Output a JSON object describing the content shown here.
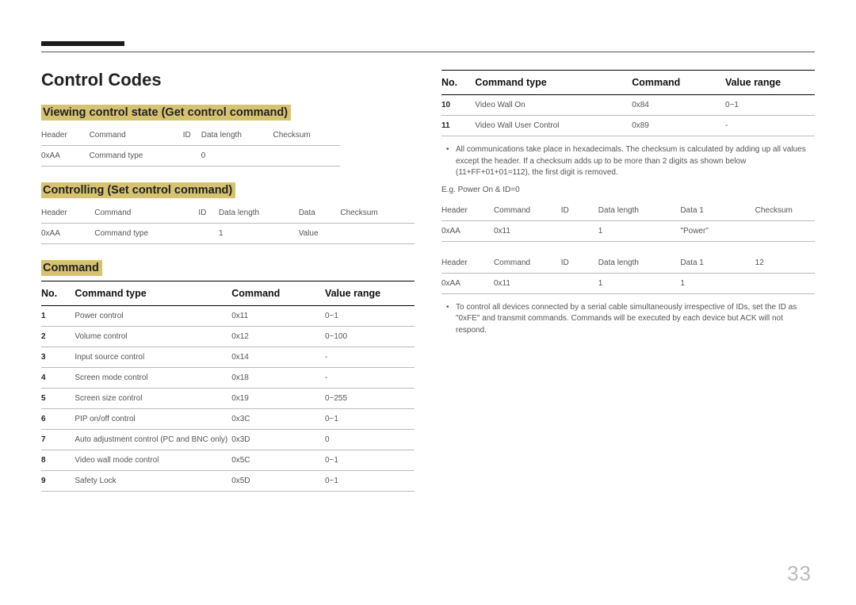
{
  "page_title": "Control Codes",
  "page_number": "33",
  "left": {
    "sec1": {
      "heading": "Viewing control state (Get control command)",
      "cols": [
        "Header",
        "Command",
        "ID",
        "Data length",
        "Checksum"
      ],
      "row": [
        "0xAA",
        "Command type",
        "",
        "0",
        ""
      ]
    },
    "sec2": {
      "heading": "Controlling (Set control command)",
      "cols": [
        "Header",
        "Command",
        "ID",
        "Data length",
        "Data",
        "Checksum"
      ],
      "row": [
        "0xAA",
        "Command type",
        "",
        "1",
        "Value",
        ""
      ]
    },
    "cmd_heading": "Command",
    "cmd_cols": {
      "no": "No.",
      "type": "Command type",
      "cmd": "Command",
      "range": "Value range"
    },
    "cmds": [
      {
        "no": "1",
        "type": "Power control",
        "cmd": "0x11",
        "range": "0~1"
      },
      {
        "no": "2",
        "type": "Volume control",
        "cmd": "0x12",
        "range": "0~100"
      },
      {
        "no": "3",
        "type": "Input source control",
        "cmd": "0x14",
        "range": "-"
      },
      {
        "no": "4",
        "type": "Screen mode control",
        "cmd": "0x18",
        "range": "-"
      },
      {
        "no": "5",
        "type": "Screen size control",
        "cmd": "0x19",
        "range": "0~255"
      },
      {
        "no": "6",
        "type": "PIP on/off control",
        "cmd": "0x3C",
        "range": "0~1"
      },
      {
        "no": "7",
        "type": "Auto adjustment control (PC and BNC only)",
        "cmd": "0x3D",
        "range": "0"
      },
      {
        "no": "8",
        "type": "Video wall mode control",
        "cmd": "0x5C",
        "range": "0~1"
      },
      {
        "no": "9",
        "type": "Safety Lock",
        "cmd": "0x5D",
        "range": "0~1"
      }
    ]
  },
  "right": {
    "cmd_cols": {
      "no": "No.",
      "type": "Command type",
      "cmd": "Command",
      "range": "Value range"
    },
    "cmds": [
      {
        "no": "10",
        "type": "Video Wall On",
        "cmd": "0x84",
        "range": "0~1"
      },
      {
        "no": "11",
        "type": "Video Wall User Control",
        "cmd": "0x89",
        "range": "-"
      }
    ],
    "note1": "All communications take place in hexadecimals. The checksum is calculated by adding up all values except the header. If a checksum adds up to be more than 2 digits as shown below (11+FF+01+01=112), the first digit is removed.",
    "eg": "E.g. Power On & ID=0",
    "t1": {
      "cols": [
        "Header",
        "Command",
        "ID",
        "Data length",
        "Data 1",
        "Checksum"
      ],
      "row": [
        "0xAA",
        "0x11",
        "",
        "1",
        "\"Power\"",
        ""
      ]
    },
    "t2": {
      "cols": [
        "Header",
        "Command",
        "ID",
        "Data length",
        "Data 1",
        "12"
      ],
      "row": [
        "0xAA",
        "0x11",
        "",
        "1",
        "1",
        ""
      ]
    },
    "note2": "To control all devices connected by a serial cable simultaneously irrespective of IDs, set the ID as \"0xFE\" and transmit commands. Commands will be executed by each device but ACK will not respond."
  }
}
